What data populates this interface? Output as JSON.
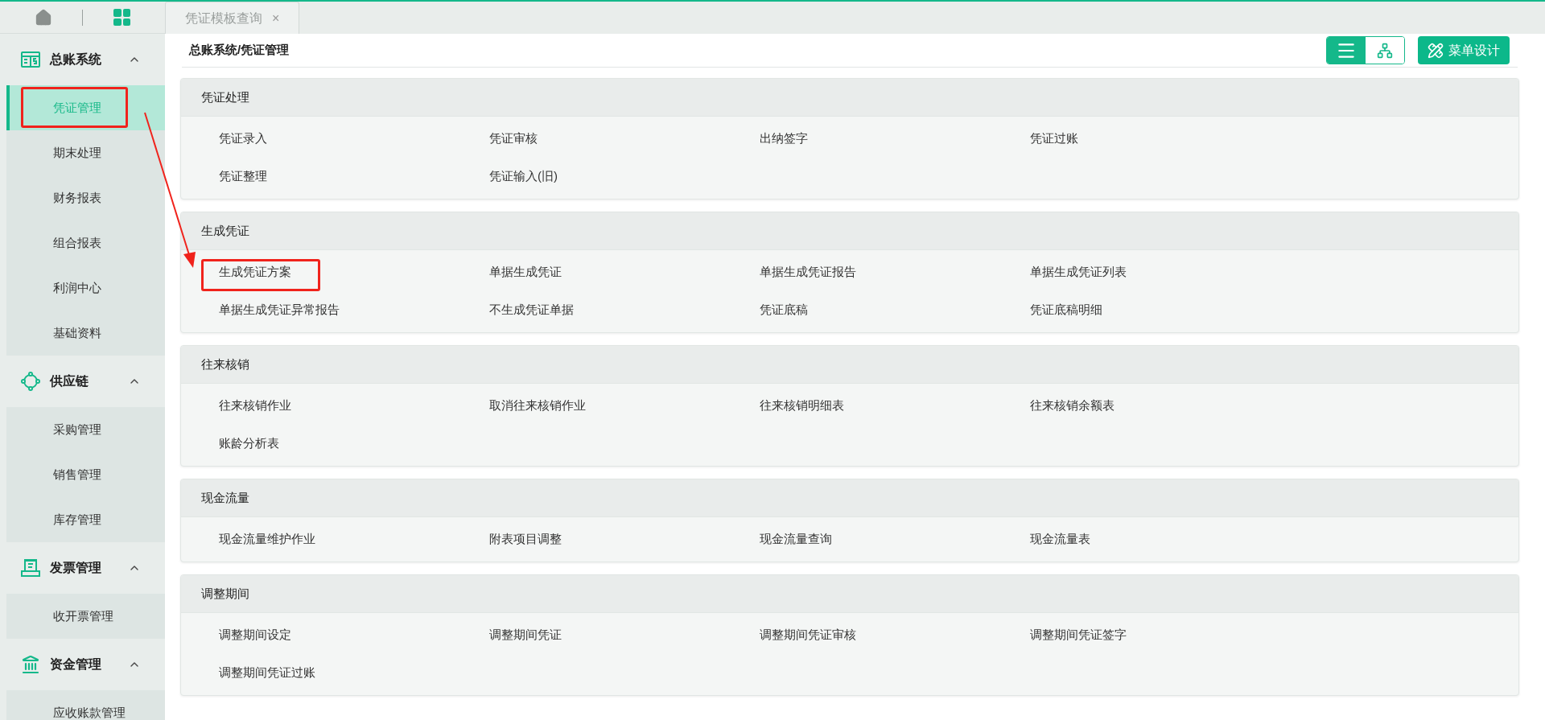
{
  "top_bar": {
    "tabs": [
      {
        "label": "凭证模板查询",
        "close": "×",
        "selected": true
      }
    ]
  },
  "sidebar": {
    "groups": [
      {
        "title": "总账系统",
        "kind": "ledger",
        "expanded": true,
        "items": [
          {
            "label": "凭证管理",
            "selected": true
          },
          {
            "label": "期末处理",
            "selected": false
          },
          {
            "label": "财务报表",
            "selected": false
          },
          {
            "label": "组合报表",
            "selected": false
          },
          {
            "label": "利润中心",
            "selected": false
          },
          {
            "label": "基础资料",
            "selected": false
          }
        ]
      },
      {
        "title": "供应链",
        "kind": "chain",
        "expanded": true,
        "items": [
          {
            "label": "采购管理",
            "selected": false
          },
          {
            "label": "销售管理",
            "selected": false
          },
          {
            "label": "库存管理",
            "selected": false
          }
        ]
      },
      {
        "title": "发票管理",
        "kind": "invoice",
        "expanded": true,
        "items": [
          {
            "label": "收开票管理",
            "selected": false
          }
        ]
      },
      {
        "title": "资金管理",
        "kind": "bank",
        "expanded": true,
        "items": [
          {
            "label": "应收账款管理",
            "selected": false
          }
        ]
      }
    ]
  },
  "breadcrumb": "总账系统/凭证管理",
  "toolbar": {
    "view_toggle": [
      {
        "kind": "list",
        "selected": true
      },
      {
        "kind": "tree",
        "selected": false
      }
    ],
    "design_button": "菜单设计"
  },
  "sections": [
    {
      "title": "凭证处理",
      "items": [
        "凭证录入",
        "凭证审核",
        "出纳签字",
        "凭证过账",
        "凭证整理",
        "凭证输入(旧)"
      ]
    },
    {
      "title": "生成凭证",
      "items": [
        "生成凭证方案",
        "单据生成凭证",
        "单据生成凭证报告",
        "单据生成凭证列表",
        "单据生成凭证异常报告",
        "不生成凭证单据",
        "凭证底稿",
        "凭证底稿明细"
      ]
    },
    {
      "title": "往来核销",
      "items": [
        "往来核销作业",
        "取消往来核销作业",
        "往来核销明细表",
        "往来核销余额表",
        "账龄分析表"
      ]
    },
    {
      "title": "现金流量",
      "items": [
        "现金流量维护作业",
        "附表项目调整",
        "现金流量查询",
        "现金流量表"
      ]
    },
    {
      "title": "调整期间",
      "items": [
        "调整期间设定",
        "调整期间凭证",
        "调整期间凭证审核",
        "调整期间凭证签字",
        "调整期间凭证过账"
      ]
    }
  ]
}
